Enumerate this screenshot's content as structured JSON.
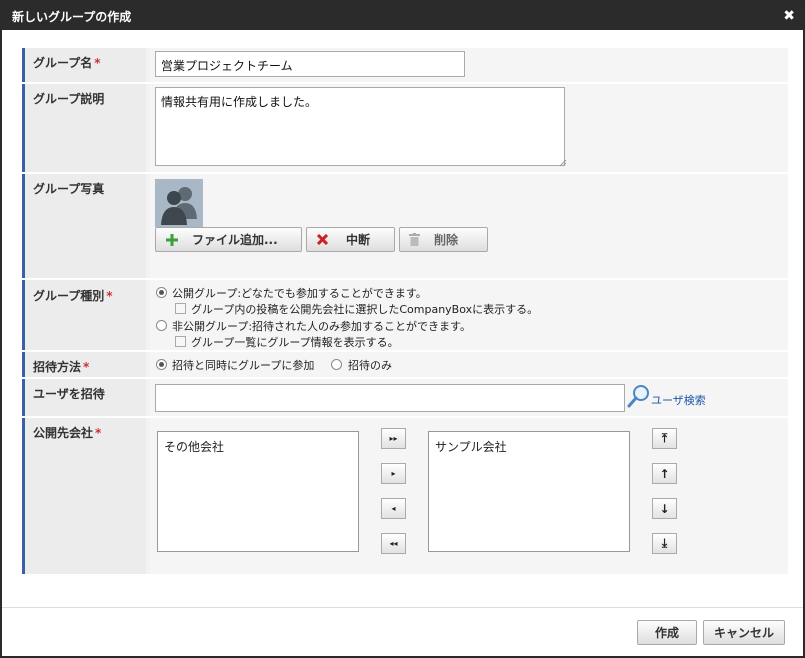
{
  "dialog": {
    "title": "新しいグループの作成",
    "close_glyph": "✖"
  },
  "fields": {
    "group_name": {
      "label": "グループ名",
      "required_mark": "*",
      "value": "営業プロジェクトチーム"
    },
    "group_desc": {
      "label": "グループ説明",
      "value": "情報共有用に作成しました。"
    },
    "group_photo": {
      "label": "グループ写真",
      "add_file_label": "ファイル追加...",
      "cancel_label": "中断",
      "delete_label": "削除"
    },
    "group_type": {
      "label": "グループ種別",
      "required_mark": "*",
      "public_option": "公開グループ:どなたでも参加することができます。",
      "public_sub_option": "グループ内の投稿を公開先会社に選択したCompanyBoxに表示する。",
      "private_option": "非公開グループ:招待された人のみ参加することができます。",
      "private_sub_option": "グループ一覧にグループ情報を表示する。"
    },
    "invite_method": {
      "label": "招待方法",
      "required_mark": "*",
      "option_join": "招待と同時にグループに参加",
      "option_invite_only": "招待のみ"
    },
    "invite_user": {
      "label": "ユーザを招待",
      "value": "",
      "search_label": "ユーザ検索"
    },
    "public_company": {
      "label": "公開先会社",
      "required_mark": "*",
      "available": [
        "その他会社"
      ],
      "selected": [
        "サンプル会社"
      ],
      "btn_add_all": "▸▸",
      "btn_add": "▸",
      "btn_remove": "◂",
      "btn_remove_all": "◂◂",
      "btn_top": "⤒",
      "btn_up": "↑",
      "btn_down": "↓",
      "btn_bottom": "⤓"
    }
  },
  "footer": {
    "create_label": "作成",
    "cancel_label": "キャンセル"
  },
  "colors": {
    "titlebar": "#2b2b2b",
    "label_accent": "#3b5ea9",
    "required": "#d03030",
    "link": "#1a56a8",
    "add_icon": "#3aa03a",
    "cancel_icon": "#cc2222"
  }
}
